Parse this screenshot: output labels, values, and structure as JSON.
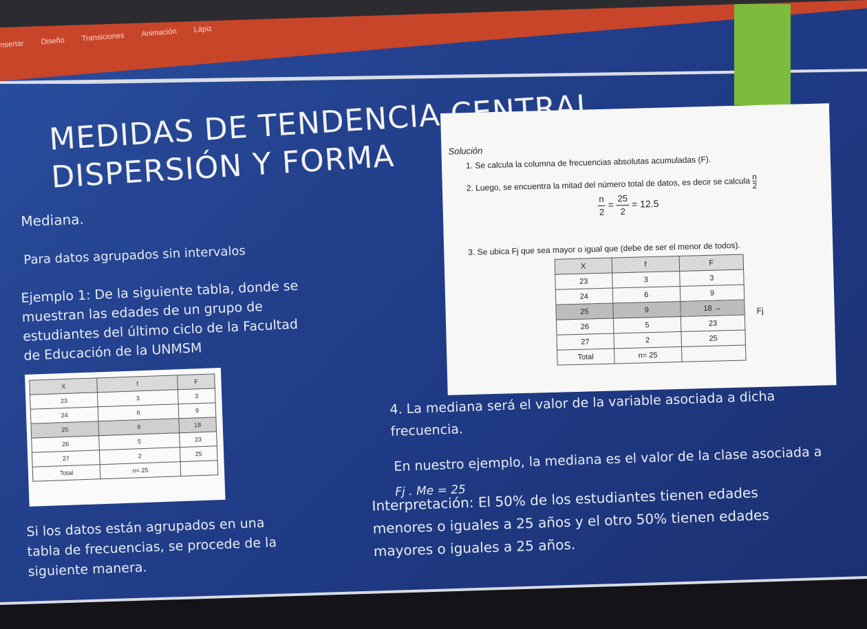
{
  "ribbon": {
    "tabs": [
      "nsertar",
      "Diseño",
      "Transiciones",
      "Animación",
      "Lápiz"
    ]
  },
  "slide": {
    "title_line1": "MEDIDAS DE TENDENCIA CENTRAL,",
    "title_line2": "DISPERSIÓN Y FORMA",
    "heading": "Mediana.",
    "subheading": "Para datos agrupados sin intervalos",
    "example_lines": [
      "Ejemplo 1: De la siguiente tabla, donde se",
      "muestran las edades de un grupo de",
      "estudiantes del último ciclo de la Facultad",
      "de Educación de la UNMSM"
    ],
    "closing_lines": [
      "Si los datos están agrupados en una",
      "tabla de frecuencias, se procede de la",
      "siguiente manera."
    ],
    "table": {
      "headers": [
        "X",
        "f",
        "F"
      ],
      "rows": [
        [
          "23",
          "3",
          "3"
        ],
        [
          "24",
          "6",
          "9"
        ],
        [
          "25",
          "9",
          "18"
        ],
        [
          "26",
          "5",
          "23"
        ],
        [
          "27",
          "2",
          "25"
        ],
        [
          "Total",
          "n= 25",
          ""
        ]
      ]
    },
    "solution": {
      "label": "Solución",
      "step1": "1. Se calcula la columna de frecuencias absolutas acumuladas (F).",
      "step2": "2. Luego, se encuentra la mitad del número total de datos, es decir se calcula",
      "step2_frac_num": "n",
      "step2_frac_den": "2",
      "formula": {
        "n": "n",
        "two": "2",
        "eq": "=",
        "num": "25",
        "den": "2",
        "result": "= 12.5"
      },
      "step3": "3. Se ubica Fj que sea mayor o igual que (debe de ser el menor de todos).",
      "fj_label": "Fj",
      "arrow": "→"
    },
    "step4_lines": [
      "4. La mediana será el valor de la variable asociada a dicha",
      "frecuencia."
    ],
    "example_result": "En nuestro ejemplo, la mediana es el valor de la clase asociada a",
    "fj_handwritten": "Fj . Me = 25",
    "interpretation_lines": [
      "Interpretación: El 50% de los estudiantes tienen edades",
      "menores o iguales a 25 años y el  otro 50% tienen edades",
      "mayores o iguales a 25 años."
    ]
  },
  "colors": {
    "slide_bg": "#23408c",
    "ribbon": "#c8452a",
    "accent_green": "#7dbb3c"
  }
}
